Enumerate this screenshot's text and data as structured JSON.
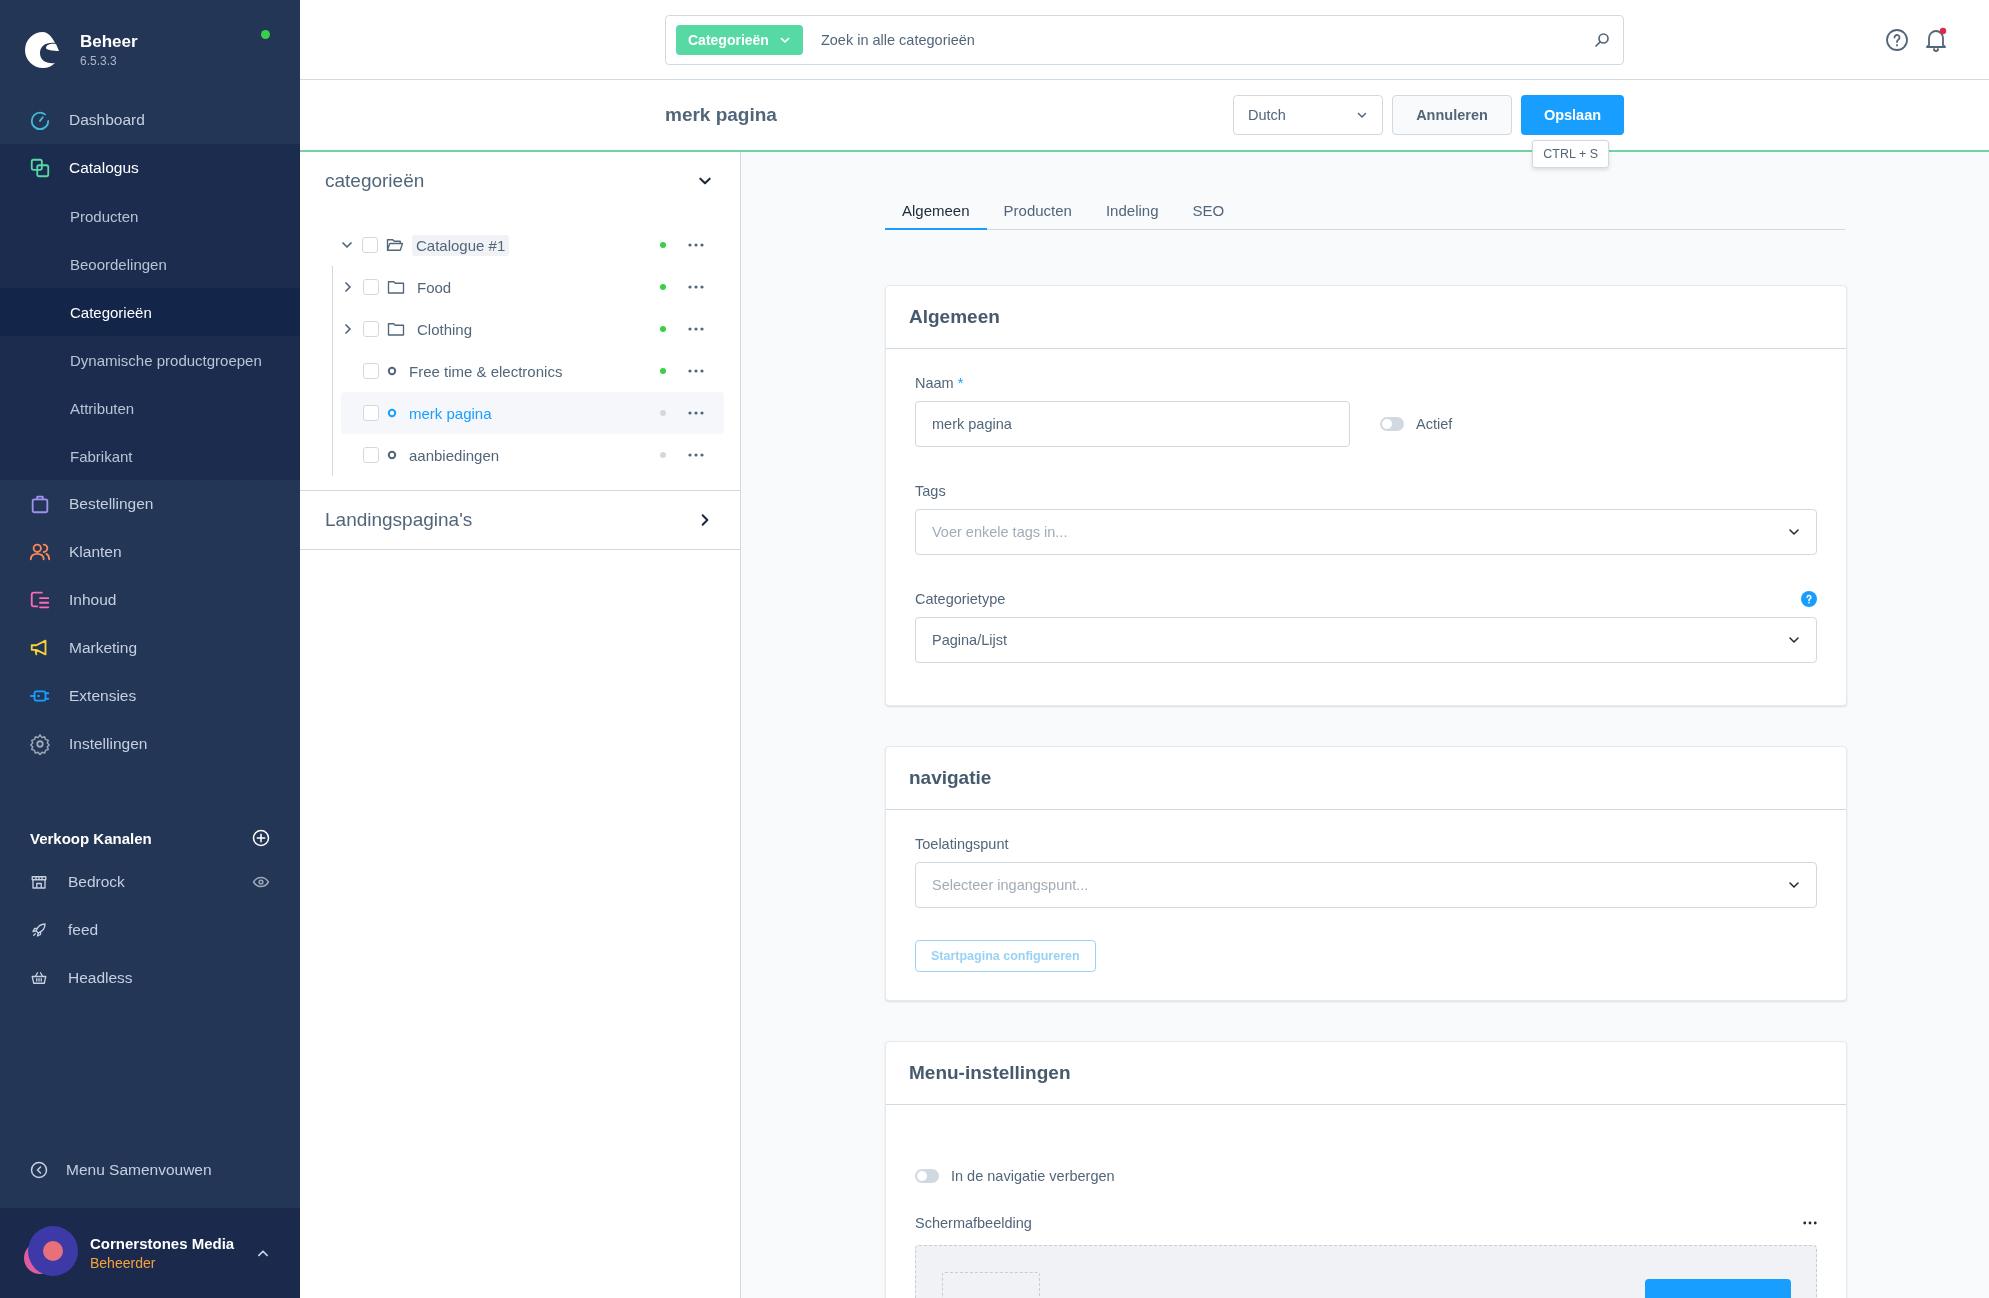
{
  "sidebar": {
    "brand": {
      "title": "Beheer",
      "version": "6.5.3.3",
      "online": true
    },
    "nav": [
      {
        "label": "Dashboard",
        "selected": false
      },
      {
        "label": "Catalogus",
        "selected": true,
        "children": [
          {
            "label": "Producten",
            "selected": false
          },
          {
            "label": "Beoordelingen",
            "selected": false
          },
          {
            "label": "Categorieën",
            "selected": true
          },
          {
            "label": "Dynamische productgroepen",
            "selected": false
          },
          {
            "label": "Attributen",
            "selected": false
          },
          {
            "label": "Fabrikant",
            "selected": false
          }
        ]
      },
      {
        "label": "Bestellingen",
        "selected": false
      },
      {
        "label": "Klanten",
        "selected": false
      },
      {
        "label": "Inhoud",
        "selected": false
      },
      {
        "label": "Marketing",
        "selected": false
      },
      {
        "label": "Extensies",
        "selected": false
      },
      {
        "label": "Instellingen",
        "selected": false
      }
    ],
    "channels": {
      "title": "Verkoop Kanalen",
      "items": [
        {
          "label": "Bedrock",
          "preview": true
        },
        {
          "label": "feed",
          "preview": false
        },
        {
          "label": "Headless",
          "preview": false
        }
      ]
    },
    "collapse": "Menu Samenvouwen",
    "user": {
      "name": "Cornerstones Media",
      "role": "Beheerder"
    }
  },
  "topbar": {
    "search": {
      "scope": "Categorieën",
      "placeholder": "Zoek in alle categorieën"
    },
    "unread": true
  },
  "header": {
    "title": "merk pagina",
    "language": "Dutch",
    "cancel": "Annuleren",
    "save": "Opslaan",
    "tooltip": "CTRL + S"
  },
  "tree_panel": [
    {
      "title": "categorieën",
      "expanded": true,
      "nodes": [
        {
          "label": "Catalogue #1",
          "kind": "root",
          "expanded": true,
          "checked": false,
          "active": true,
          "selected": false,
          "children": [
            {
              "label": "Food",
              "kind": "folder",
              "expanded": false,
              "checked": false,
              "active": true,
              "selected": false
            },
            {
              "label": "Clothing",
              "kind": "folder",
              "expanded": false,
              "checked": false,
              "active": true,
              "selected": false
            },
            {
              "label": "Free time & electronics",
              "kind": "page",
              "checked": false,
              "active": true,
              "selected": false
            },
            {
              "label": "merk pagina",
              "kind": "page",
              "checked": false,
              "active": false,
              "selected": true
            },
            {
              "label": "aanbiedingen",
              "kind": "page",
              "checked": false,
              "active": false,
              "selected": false
            }
          ]
        }
      ]
    },
    {
      "title": "Landingspagina's",
      "expanded": false
    }
  ],
  "tabs": [
    {
      "label": "Algemeen",
      "selected": true
    },
    {
      "label": "Producten",
      "selected": false
    },
    {
      "label": "Indeling",
      "selected": false
    },
    {
      "label": "SEO",
      "selected": false
    }
  ],
  "cards": [
    {
      "title": "Algemeen",
      "rows": [
        [
          {
            "kind": "text",
            "label": "Naam",
            "required_mark": "*",
            "value": "merk pagina"
          },
          {
            "kind": "toggle",
            "label": "Actief",
            "on": false
          }
        ],
        [
          {
            "kind": "select",
            "label": "Tags",
            "placeholder": "Voer enkele tags in..."
          }
        ],
        [
          {
            "kind": "select",
            "label": "Categorietype",
            "value": "Pagina/Lijst",
            "help": true
          }
        ]
      ]
    },
    {
      "title": "navigatie",
      "rows": [
        [
          {
            "kind": "select",
            "label": "Toelatingspunt",
            "placeholder": "Selecteer ingangspunt..."
          }
        ],
        [
          {
            "kind": "button",
            "label": "Startpagina configureren",
            "disabled": true
          }
        ]
      ]
    },
    {
      "title": "Menu-instellingen",
      "rows": [
        [
          {
            "kind": "toggle",
            "label": "In de navigatie verbergen",
            "on": false
          }
        ],
        [
          {
            "kind": "media",
            "label": "Schermafbeelding"
          }
        ]
      ]
    }
  ]
}
